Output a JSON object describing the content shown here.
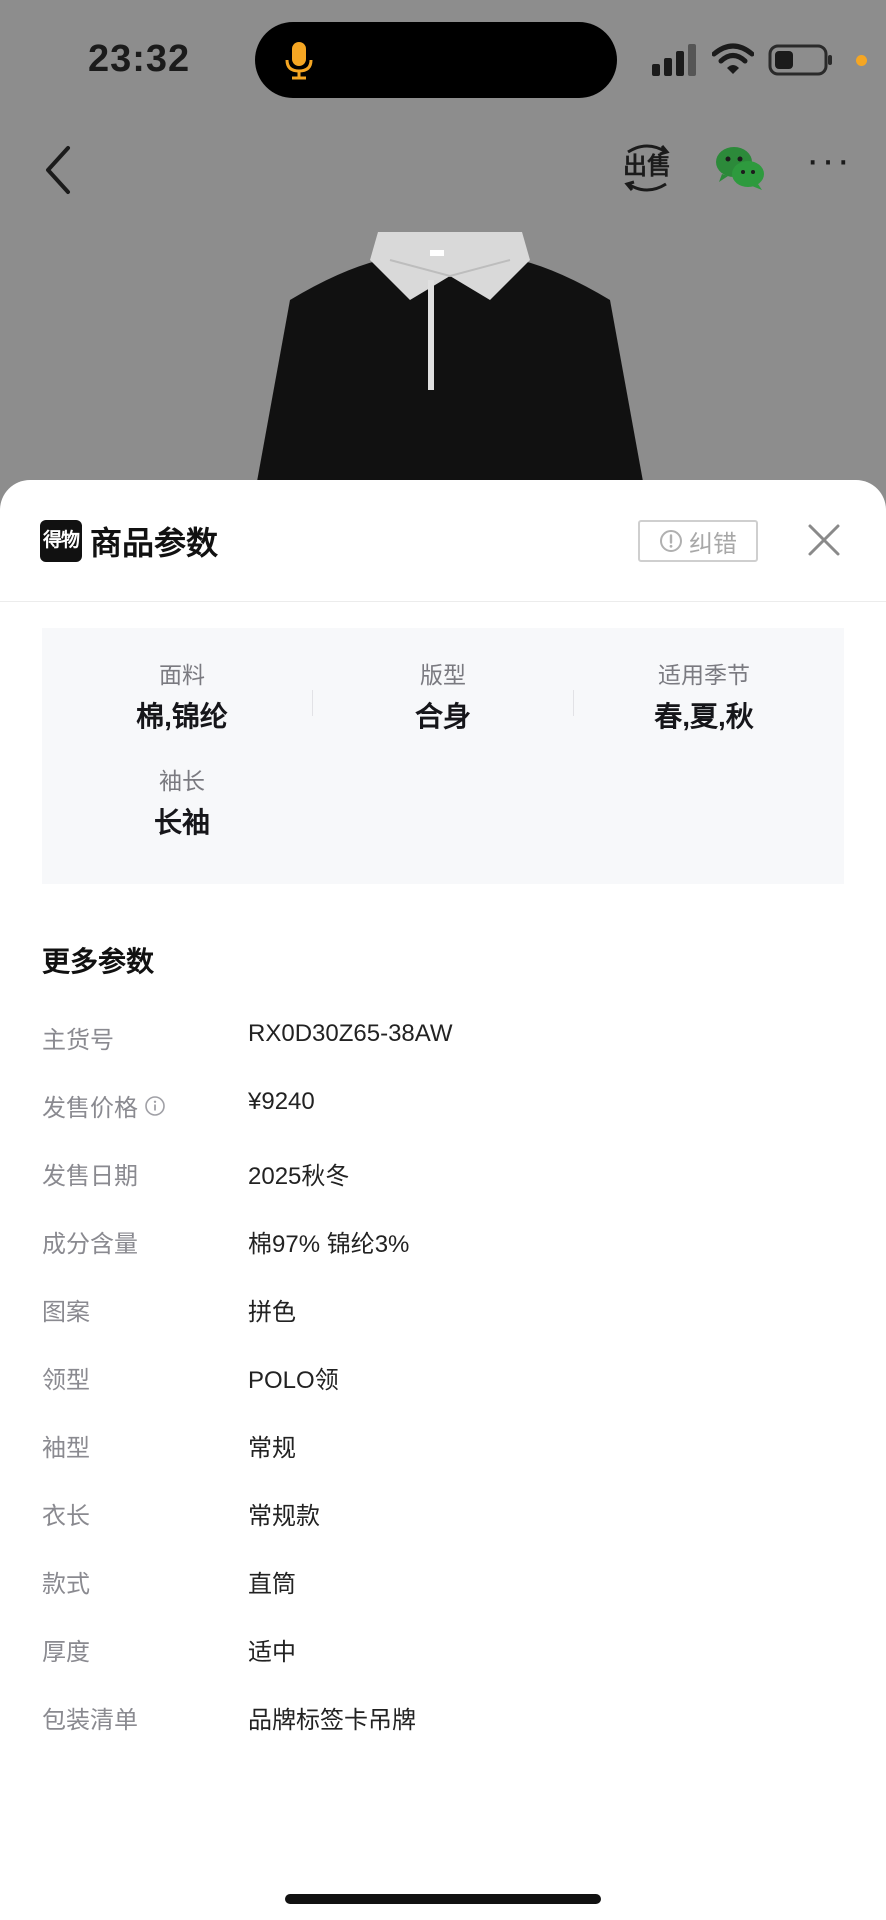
{
  "status": {
    "time": "23:32"
  },
  "sheet": {
    "brand_logo_text": "得物",
    "title": "商品参数",
    "report_label": "纠错"
  },
  "key_params": [
    {
      "label": "面料",
      "value": "棉,锦纶"
    },
    {
      "label": "版型",
      "value": "合身"
    },
    {
      "label": "适用季节",
      "value": "春,夏,秋"
    },
    {
      "label": "袖长",
      "value": "长袖"
    }
  ],
  "more_params": {
    "title": "更多参数",
    "rows": [
      {
        "label": "主货号",
        "value": "RX0D30Z65-38AW"
      },
      {
        "label": "发售价格",
        "value": "¥9240"
      },
      {
        "label": "发售日期",
        "value": "2025秋冬"
      },
      {
        "label": "成分含量",
        "value": "棉97% 锦纶3%"
      },
      {
        "label": "图案",
        "value": "拼色"
      },
      {
        "label": "领型",
        "value": "POLO领"
      },
      {
        "label": "袖型",
        "value": "常规"
      },
      {
        "label": "衣长",
        "value": "常规款"
      },
      {
        "label": "款式",
        "value": "直筒"
      },
      {
        "label": "厚度",
        "value": "适中"
      },
      {
        "label": "包装清单",
        "value": "品牌标签卡吊牌"
      }
    ]
  },
  "icons": {
    "status": [
      "microphone-icon",
      "cellular-signal-icon",
      "wifi-icon",
      "battery-icon"
    ],
    "nav": [
      "back-arrow-icon",
      "sell-icon",
      "wechat-icon",
      "more-icon"
    ],
    "sheet": [
      "alert-circle-icon",
      "close-icon",
      "info-icon"
    ]
  },
  "colors": {
    "accent_orange": "#f5a623",
    "wechat_green": "#2c8a3a",
    "overlay_gray": "#8d8d8d"
  }
}
